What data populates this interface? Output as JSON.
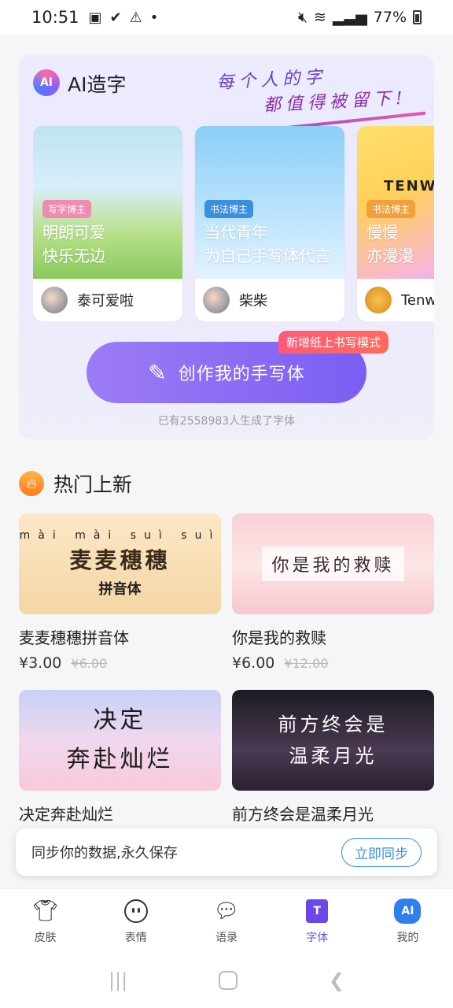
{
  "status": {
    "time": "10:51",
    "battery": "77%"
  },
  "ai": {
    "title": "AI造字",
    "logo": "AI",
    "slogan": {
      "line1": "每个人的字",
      "line2": "都值得被留下!"
    },
    "cards": [
      {
        "tag": "写字博主",
        "text1": "明朗可爱",
        "text2": "快乐无边",
        "author": "泰可爱啦"
      },
      {
        "tag": "书法博主",
        "text1": "当代青年",
        "text2": "为自己手写体代言",
        "author": "柴柴"
      },
      {
        "tag": "书法博主",
        "text1": "慢慢",
        "text2": "亦漫漫",
        "author": "Tenw",
        "mark": "TENW"
      }
    ],
    "create_label": "创作我的手写体",
    "new_badge": "新增纸上书写模式",
    "count_text": "已有2558983人生成了字体"
  },
  "hot": {
    "title": "热门上新",
    "items": [
      {
        "name": "麦麦穗穗拼音体",
        "price": "¥3.00",
        "old": "¥6.00",
        "art": "麦麦穗穗",
        "pinyin": "mài mài suì suì",
        "sub": "拼音体"
      },
      {
        "name": "你是我的救赎",
        "price": "¥6.00",
        "old": "¥12.00",
        "art": "你是我的救赎"
      },
      {
        "name": "决定奔赴灿烂",
        "art1": "决定",
        "art2": "奔赴灿烂"
      },
      {
        "name": "前方终会是温柔月光",
        "art1": "前方终会是",
        "art2": "温柔月光"
      }
    ]
  },
  "sync": {
    "text": "同步你的数据,永久保存",
    "button": "立即同步"
  },
  "nav": [
    {
      "label": "皮肤"
    },
    {
      "label": "表情"
    },
    {
      "label": "语录"
    },
    {
      "label": "字体"
    },
    {
      "label": "我的"
    }
  ],
  "nav_icons": {
    "font": "T",
    "mine": "AI"
  }
}
